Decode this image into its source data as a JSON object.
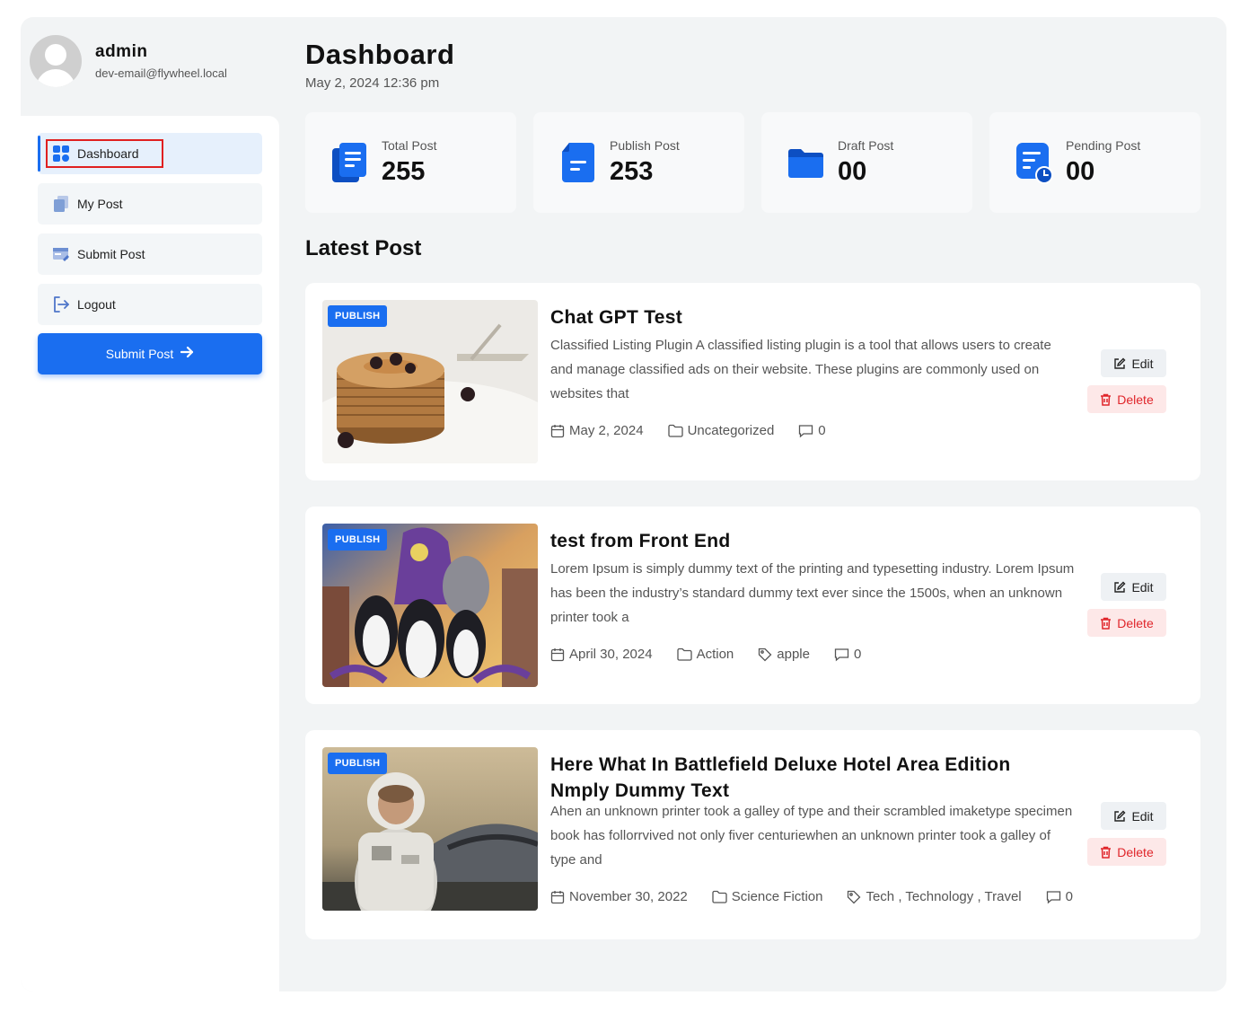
{
  "user": {
    "name": "admin",
    "email": "dev-email@flywheel.local"
  },
  "sidebar": {
    "items": [
      {
        "label": "Dashboard",
        "icon": "dashboard-grid-icon",
        "active": true
      },
      {
        "label": "My Post",
        "icon": "pages-icon"
      },
      {
        "label": "Submit Post",
        "icon": "edit-card-icon"
      },
      {
        "label": "Logout",
        "icon": "logout-icon"
      }
    ],
    "submit_button": "Submit Post",
    "submit_icon": "arrow-right-icon"
  },
  "page": {
    "title": "Dashboard",
    "date": "May 2, 2024 12:36 pm"
  },
  "stats": [
    {
      "label": "Total Post",
      "value": "255",
      "icon": "documents-icon"
    },
    {
      "label": "Publish Post",
      "value": "253",
      "icon": "document-icon"
    },
    {
      "label": "Draft Post",
      "value": "00",
      "icon": "folder-icon"
    },
    {
      "label": "Pending Post",
      "value": "00",
      "icon": "pending-clock-icon"
    }
  ],
  "latest": {
    "title": "Latest Post",
    "edit_label": "Edit",
    "delete_label": "Delete",
    "posts": [
      {
        "badge": "PUBLISH",
        "title": "Chat GPT Test",
        "excerpt": "Classified Listing Plugin A classified listing plugin is a tool that allows users to create and manage classified ads on their website. These plugins are commonly used on websites that",
        "date": "May 2, 2024",
        "category": "Uncategorized",
        "tags": "",
        "comments": "0"
      },
      {
        "badge": "PUBLISH",
        "title": "test from Front End",
        "excerpt": "Lorem Ipsum is simply dummy text of the printing and typesetting industry. Lorem Ipsum has been the industry’s standard dummy text ever since the 1500s, when an unknown printer took a",
        "date": "April 30, 2024",
        "category": "Action",
        "tags": "apple",
        "comments": "0"
      },
      {
        "badge": "PUBLISH",
        "title": "Here What In Battlefield Deluxe Hotel Area Edition Nmply Dummy Text",
        "excerpt": "Ahen an unknown printer took a galley of type and their scrambled imaketype specimen book has follorrvived not only fiver centuriewhen an unknown printer took a galley of type and",
        "date": "November 30, 2022",
        "category": "Science Fiction",
        "tags": "Tech , Technology , Travel",
        "comments": "0"
      }
    ]
  },
  "colors": {
    "accent": "#1a6ef0",
    "danger": "#e0252a",
    "background": "#f2f4f5"
  }
}
